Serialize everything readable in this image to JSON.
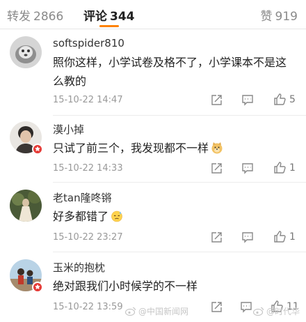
{
  "tabs": {
    "reposts": {
      "label": "转发",
      "count": "2866"
    },
    "comments": {
      "label": "评论",
      "count": "344"
    },
    "likes": {
      "label": "赞",
      "count": "919"
    }
  },
  "comments": [
    {
      "username": "softspider810",
      "text": "照你这样，小学试卷及格不了，小学课本不是这么教的",
      "time": "15-10-22 14:47",
      "likes": "5",
      "emoji": null
    },
    {
      "username": "漠小掉",
      "text": "只试了前三个，我发现都不一样",
      "time": "15-10-22 14:33",
      "likes": "1",
      "emoji": "doge-emoji"
    },
    {
      "username": "老tan隆咚锵",
      "text": "好多都错了",
      "time": "15-10-22 23:27",
      "likes": "1",
      "emoji": "sweat-emoji"
    },
    {
      "username": "玉米的抱枕",
      "text": "绝对跟我们小时候学的不一样",
      "time": "15-10-22 13:59",
      "likes": "11",
      "emoji": null
    }
  ],
  "watermark": {
    "left": "@中国新闻网",
    "right": "@时代华"
  },
  "icons": [
    "repost-icon",
    "comment-icon",
    "like-icon",
    "verified-badge-icon",
    "doge-emoji",
    "sweat-emoji",
    "weibo-logo-icon"
  ],
  "colors": {
    "accent": "#ff8200",
    "verified_badge": "#e53935",
    "secondary_text": "#999999"
  }
}
